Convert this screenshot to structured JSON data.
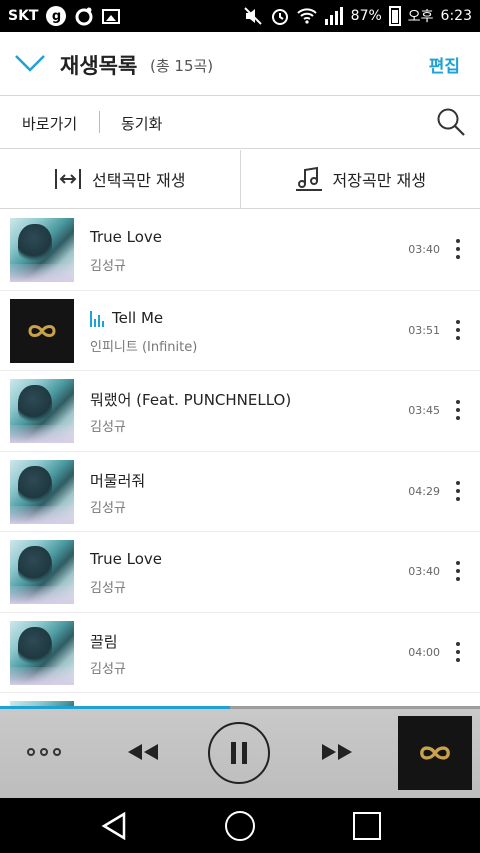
{
  "status_bar": {
    "carrier": "SKT",
    "icon_g": "g",
    "battery": "87%",
    "ampm": "오후",
    "time": "6:23"
  },
  "header": {
    "title": "재생목록",
    "count": "(총 15곡)",
    "edit_label": "편집"
  },
  "subbar": {
    "shortcut_label": "바로가기",
    "sync_label": "동기화"
  },
  "play_options": {
    "selected_label": "선택곡만 재생",
    "saved_label": "저장곡만 재생"
  },
  "tracks": [
    {
      "title": "True Love",
      "artist": "김성규",
      "duration": "03:40",
      "art": "photo",
      "playing": false
    },
    {
      "title": "Tell Me",
      "artist": "인피니트 (Infinite)",
      "duration": "03:51",
      "art": "infinite",
      "playing": true
    },
    {
      "title": "뭐랬어 (Feat. PUNCHNELLO)",
      "artist": "김성규",
      "duration": "03:45",
      "art": "photo",
      "playing": false
    },
    {
      "title": "머물러줘",
      "artist": "김성규",
      "duration": "04:29",
      "art": "photo",
      "playing": false
    },
    {
      "title": "True Love",
      "artist": "김성규",
      "duration": "03:40",
      "art": "photo",
      "playing": false
    },
    {
      "title": "끌림",
      "artist": "김성규",
      "duration": "04:00",
      "art": "photo",
      "playing": false
    }
  ],
  "player": {
    "progress": 0.48
  },
  "colors": {
    "accent": "#1ea2d3",
    "gold": "#c9a24a"
  }
}
